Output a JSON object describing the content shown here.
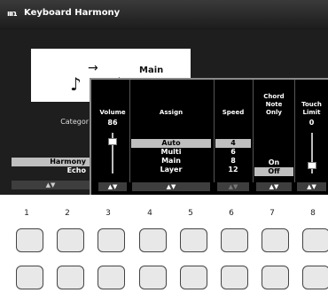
{
  "titlebar": {
    "icon_glyph": "ıııɿ",
    "icon_name": "keyboard-icon",
    "title": "Keyboard Harmony"
  },
  "background": {
    "illustration": {
      "arrow": "→",
      "text": "Main"
    },
    "category_label": "Categor",
    "types": [
      {
        "label": "Harmony",
        "selected": true
      },
      {
        "label": "Echo",
        "selected": false
      }
    ],
    "selector": "▲▼"
  },
  "overlay": {
    "columns": [
      {
        "id": "volume",
        "header": "Volume",
        "value": "86",
        "type": "slider",
        "level": 0.86,
        "footer": "▲▼",
        "footer_dim": false
      },
      {
        "id": "assign",
        "header": "Assign",
        "type": "list",
        "options": [
          {
            "label": "Auto",
            "selected": true
          },
          {
            "label": "Multi",
            "selected": false
          },
          {
            "label": "Main",
            "selected": false
          },
          {
            "label": "Layer",
            "selected": false
          }
        ],
        "footer": "▲▼",
        "footer_dim": false
      },
      {
        "id": "speed",
        "header": "Speed",
        "type": "list",
        "options": [
          {
            "label": "4",
            "selected": true
          },
          {
            "label": "6",
            "selected": false
          },
          {
            "label": "8",
            "selected": false
          },
          {
            "label": "12",
            "selected": false
          }
        ],
        "footer": "▲▼",
        "footer_dim": true
      },
      {
        "id": "chord-note-only",
        "header_lines": [
          "Chord",
          "Note",
          "Only"
        ],
        "type": "list",
        "options": [
          {
            "label": "On",
            "selected": false
          },
          {
            "label": "Off",
            "selected": true
          }
        ],
        "footer": "▲▼",
        "footer_dim": false
      },
      {
        "id": "touch-limit",
        "header_lines": [
          "Touch",
          "Limit"
        ],
        "value": "0",
        "type": "slider",
        "level": 0.0,
        "footer": "▲▼",
        "footer_dim": false
      }
    ]
  },
  "hardware_buttons": {
    "numbers": [
      "1",
      "2",
      "3",
      "4",
      "5",
      "6",
      "7",
      "8"
    ]
  }
}
